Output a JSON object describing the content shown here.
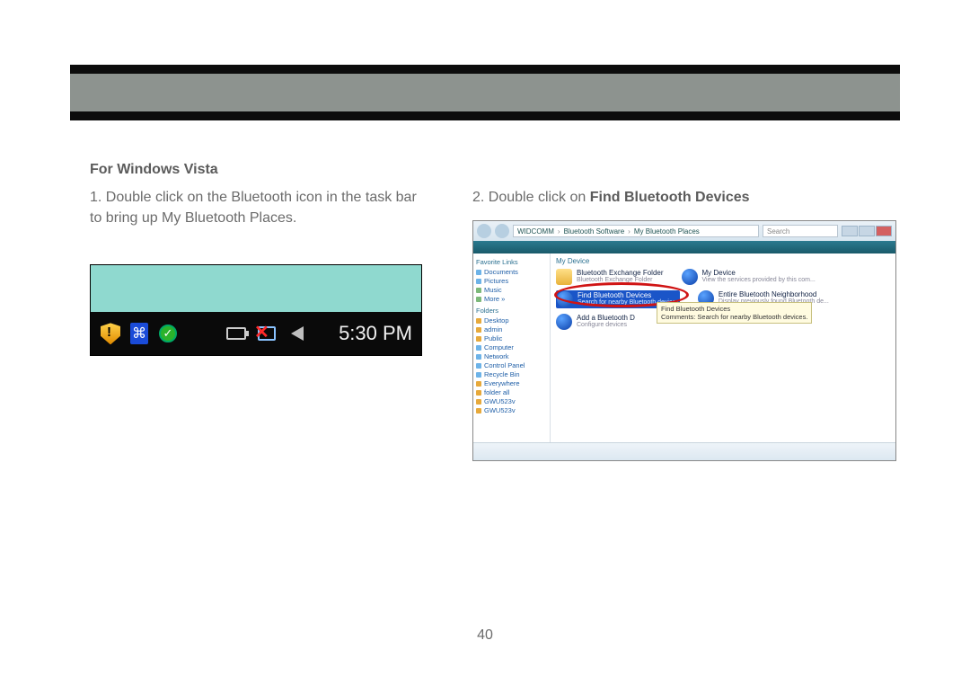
{
  "header": {},
  "section_title": "For Windows Vista",
  "left": {
    "step_num": "1.",
    "step_text": "Double click on the Bluetooth icon in the task bar to bring up My Bluetooth Places.",
    "taskbar": {
      "clock": "5:30 PM"
    }
  },
  "right": {
    "step_num": "2.",
    "step_prefix": "Double click on ",
    "step_bold": "Find Bluetooth Devices",
    "explorer": {
      "breadcrumb": [
        "WIDCOMM",
        "Bluetooth Software",
        "My Bluetooth Places"
      ],
      "search_placeholder": "Search",
      "nav": {
        "fav_header": "Favorite Links",
        "fav_items": [
          "Documents",
          "Pictures",
          "Music",
          "More »"
        ],
        "folders_header": "Folders",
        "folder_items": [
          "Desktop",
          "admin",
          "Public",
          "Computer",
          "Network",
          "Control Panel",
          "Recycle Bin",
          "Everywhere",
          "folder all",
          "GWU523v",
          "GWU523v"
        ]
      },
      "group_label": "My Device",
      "items": {
        "exchange": {
          "title": "Bluetooth Exchange Folder",
          "sub": "Bluetooth Exchange Folder"
        },
        "mydevice": {
          "title": "My Device",
          "sub": "View the services provided by this com..."
        },
        "find": {
          "title": "Find Bluetooth Devices",
          "sub": "Search for nearby Bluetooth devices"
        },
        "entire": {
          "title": "Entire Bluetooth Neighborhood",
          "sub": "Display previously found Bluetooth de..."
        },
        "add": {
          "title": "Add a Bluetooth D",
          "sub": "Configure devices"
        }
      },
      "tooltip": {
        "t": "Find Bluetooth Devices",
        "s": "Comments: Search for nearby Bluetooth devices."
      }
    }
  },
  "page_number": "40"
}
